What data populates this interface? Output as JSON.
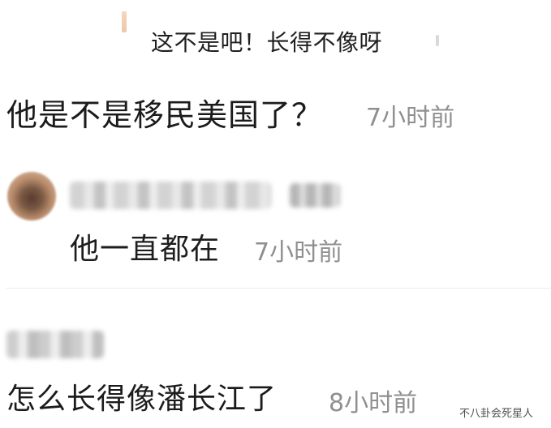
{
  "top_reply": {
    "text": "这不是吧！长得不像呀"
  },
  "comments": [
    {
      "text": "他是不是移民美国了？",
      "time": "7小时前"
    },
    {
      "text": "他一直都在",
      "time": "7小时前"
    },
    {
      "text": "怎么长得像潘长江了",
      "time": "8小时前"
    }
  ],
  "watermark": "不八卦会死星人",
  "icons": {
    "avatar": "user-avatar-blurred"
  },
  "colors": {
    "text": "#1b1b1b",
    "time": "#8f8f8f",
    "divider": "#ececec"
  }
}
